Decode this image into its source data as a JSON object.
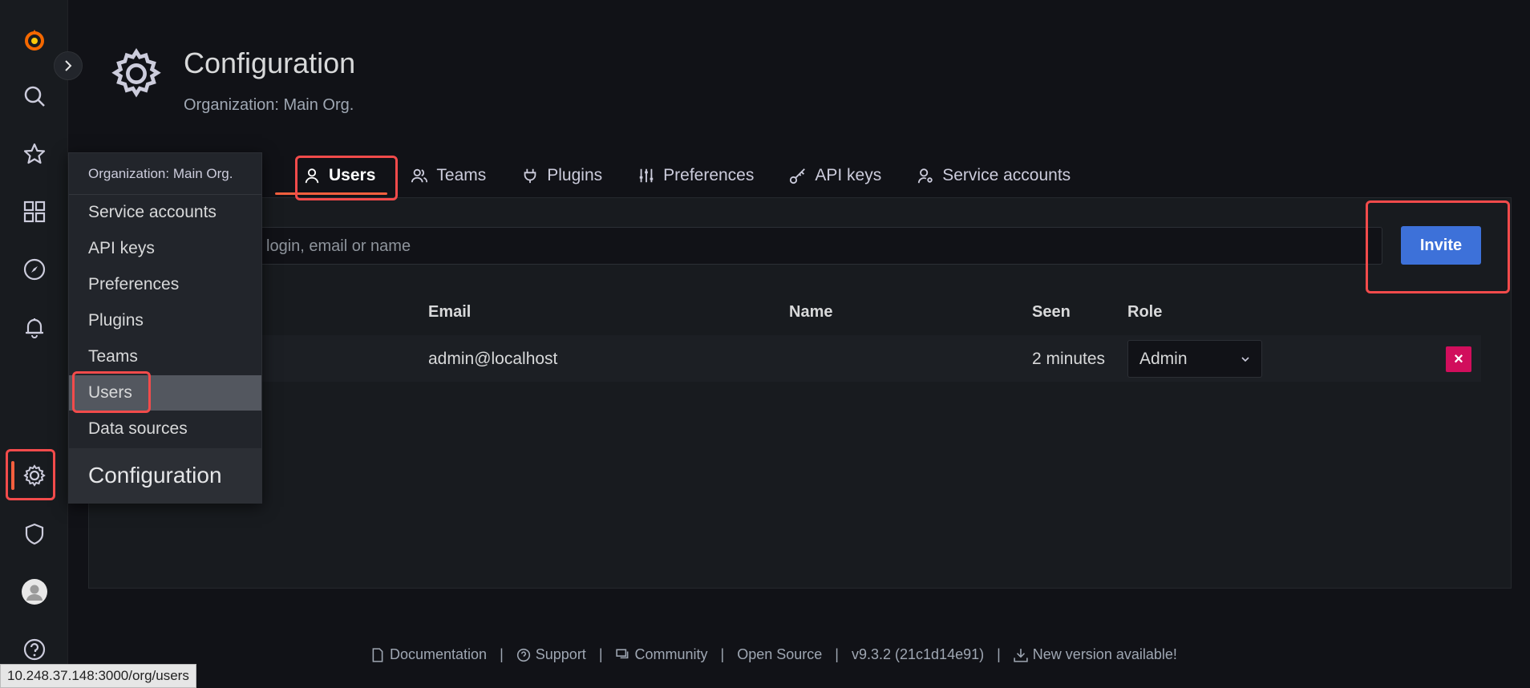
{
  "header": {
    "title": "Configuration",
    "subtitle": "Organization: Main Org."
  },
  "tabs": [
    {
      "label": "Users",
      "active": true,
      "icon": "user-icon"
    },
    {
      "label": "Teams",
      "icon": "teams-icon"
    },
    {
      "label": "Plugins",
      "icon": "plug-icon"
    },
    {
      "label": "Preferences",
      "icon": "sliders-icon"
    },
    {
      "label": "API keys",
      "icon": "key-icon"
    },
    {
      "label": "Service accounts",
      "icon": "service-account-icon"
    }
  ],
  "users": {
    "search_placeholder": "login, email or name",
    "invite_label": "Invite",
    "columns": [
      "Email",
      "Name",
      "Seen",
      "Role"
    ],
    "rows": [
      {
        "email": "admin@localhost",
        "name": "",
        "seen": "2 minutes",
        "role": "Admin"
      }
    ],
    "delete_label": "×"
  },
  "menu": {
    "header": "Organization: Main Org.",
    "items": [
      "Service accounts",
      "API keys",
      "Preferences",
      "Plugins",
      "Teams",
      "Users",
      "Data sources"
    ],
    "active_item": "Users",
    "footer": "Configuration"
  },
  "footer": {
    "documentation": "Documentation",
    "support": "Support",
    "community": "Community",
    "open_source": "Open Source",
    "version": "v9.3.2 (21c1d14e91)",
    "new_version": "New version available!",
    "separator": "|"
  },
  "status_url": "10.248.37.148:3000/org/users",
  "colors": {
    "accent": "#f55f3e",
    "primary_button": "#3d71d9",
    "danger": "#d10e5c",
    "highlight": "#f24b4b"
  }
}
